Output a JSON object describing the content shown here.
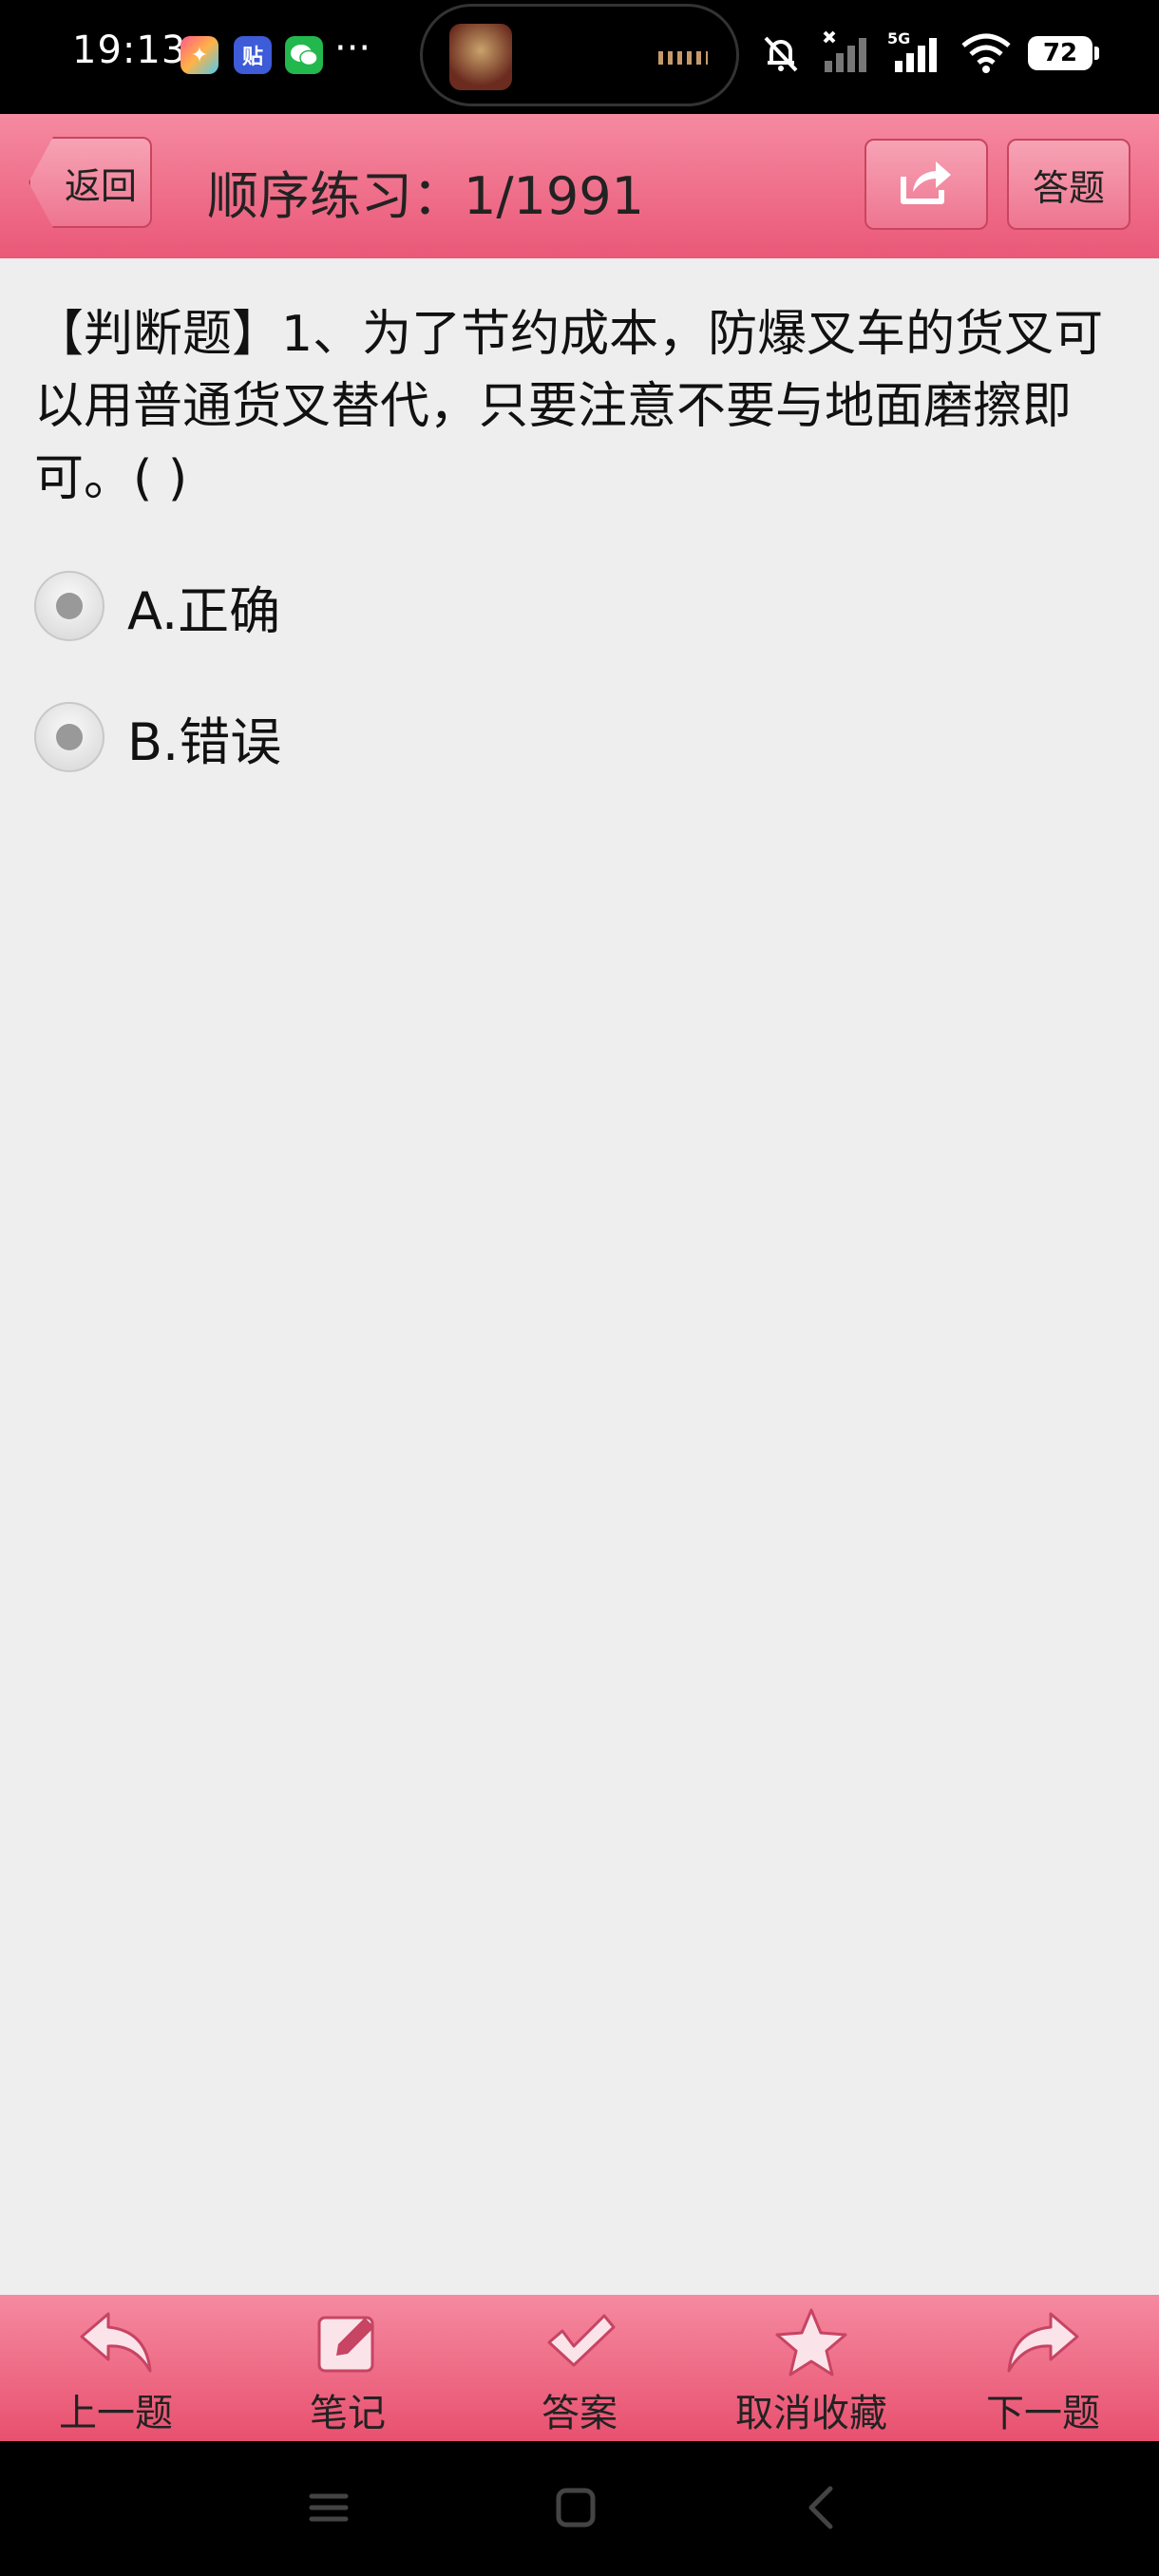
{
  "status_bar": {
    "time": "19:13",
    "app_icons": [
      "game-center-icon",
      "tieba-icon",
      "wechat-icon"
    ],
    "tieba_glyph": "贴",
    "overflow": "···",
    "network": "5G",
    "battery": "72"
  },
  "header": {
    "back_label": "返回",
    "title": "顺序练习：1/1991",
    "answer_label": "答题"
  },
  "question": {
    "text": "【判断题】1、为了节约成本，防爆叉车的货叉可以用普通货叉替代，只要注意不要与地面磨擦即可。( )"
  },
  "options": [
    {
      "label": "A.正确"
    },
    {
      "label": "B.错误"
    }
  ],
  "toolbar": {
    "prev_label": "上一题",
    "note_label": "笔记",
    "answer_label": "答案",
    "unfavorite_label": "取消收藏",
    "next_label": "下一题"
  },
  "colors": {
    "header_top": "#f58aa0",
    "header_bottom": "#ea5878",
    "background": "#eeeeee"
  }
}
